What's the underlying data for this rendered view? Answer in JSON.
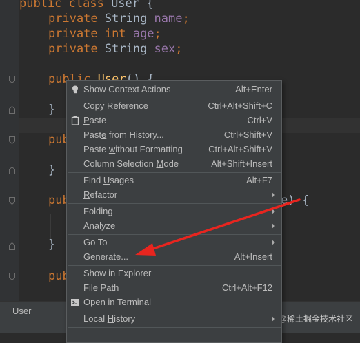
{
  "editor": {
    "lines": [
      {
        "kw": "public class ",
        "rest": "User {"
      },
      {
        "kw": "private ",
        "type": "String ",
        "field": "name",
        "end": ";"
      },
      {
        "kw": "private int ",
        "field": "age",
        "end": ";"
      },
      {
        "kw": "private ",
        "type": "String ",
        "field": "sex",
        "end": ";"
      },
      {
        "kw": "public ",
        "fn": "User",
        "rest": "() {"
      },
      {
        "brace": "}"
      },
      {
        "kw": "pub"
      },
      {
        "brace": "}"
      },
      {
        "kw": "pub",
        "tail": "e) {"
      },
      {
        "brace": "}"
      },
      {
        "kw": "pub"
      }
    ]
  },
  "context_menu": {
    "items": [
      {
        "label": "Show Context Actions",
        "shortcut": "Alt+Enter",
        "icon": "lightbulb-icon"
      },
      {
        "label_pre": "Cop",
        "label_ul": "y",
        "label_post": " Reference",
        "shortcut": "Ctrl+Alt+Shift+C"
      },
      {
        "label_pre": "",
        "label_ul": "P",
        "label_post": "aste",
        "shortcut": "Ctrl+V",
        "icon": "clipboard-icon"
      },
      {
        "label_pre": "Past",
        "label_ul": "e",
        "label_post": " from History...",
        "shortcut": "Ctrl+Shift+V"
      },
      {
        "label_pre": "Paste ",
        "label_ul": "w",
        "label_post": "ithout Formatting",
        "shortcut": "Ctrl+Alt+Shift+V"
      },
      {
        "label_pre": "Column Selection ",
        "label_ul": "M",
        "label_post": "ode",
        "shortcut": "Alt+Shift+Insert"
      },
      {
        "label_pre": "Find ",
        "label_ul": "U",
        "label_post": "sages",
        "shortcut": "Alt+F7"
      },
      {
        "label_pre": "",
        "label_ul": "R",
        "label_post": "efactor",
        "submenu": true
      },
      {
        "label": "Folding",
        "submenu": true
      },
      {
        "label": "Analyze",
        "submenu": true
      },
      {
        "label": "Go To",
        "submenu": true
      },
      {
        "label": "Generate...",
        "shortcut": "Alt+Insert"
      },
      {
        "label": "Show in Explorer"
      },
      {
        "label": "File Path",
        "shortcut": "Ctrl+Alt+F12"
      },
      {
        "label": "Open in Terminal",
        "icon": "terminal-icon"
      },
      {
        "label_pre": "Local ",
        "label_ul": "H",
        "label_post": "istory",
        "submenu": true
      }
    ]
  },
  "statusbar": {
    "tab": "User",
    "watermark": "@稀土掘金技术社区"
  },
  "colors": {
    "editor_bg": "#2b2b2b",
    "keyword": "#cc7832",
    "field": "#9876aa",
    "menu_bg": "#3c3f41",
    "annotation_arrow": "#e8251f"
  }
}
